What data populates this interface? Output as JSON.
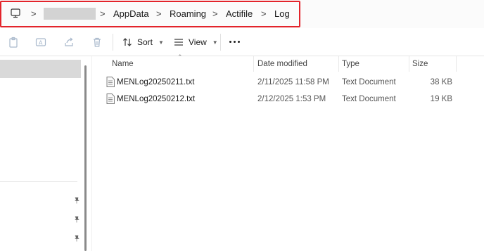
{
  "address": {
    "crumbs": [
      "AppData",
      "Roaming",
      "Actifile",
      "Log"
    ],
    "separator": ">"
  },
  "toolbar": {
    "sort_label": "Sort",
    "view_label": "View"
  },
  "columns": {
    "name": "Name",
    "date": "Date modified",
    "type": "Type",
    "size": "Size"
  },
  "files": [
    {
      "name": "MENLog20250211.txt",
      "date": "2/11/2025 11:58 PM",
      "type": "Text Document",
      "size": "38 KB"
    },
    {
      "name": "MENLog20250212.txt",
      "date": "2/12/2025 1:53 PM",
      "type": "Text Document",
      "size": "19 KB"
    }
  ],
  "colors": {
    "highlight_outline": "#e3242b",
    "selection": "#d9d9d9"
  }
}
